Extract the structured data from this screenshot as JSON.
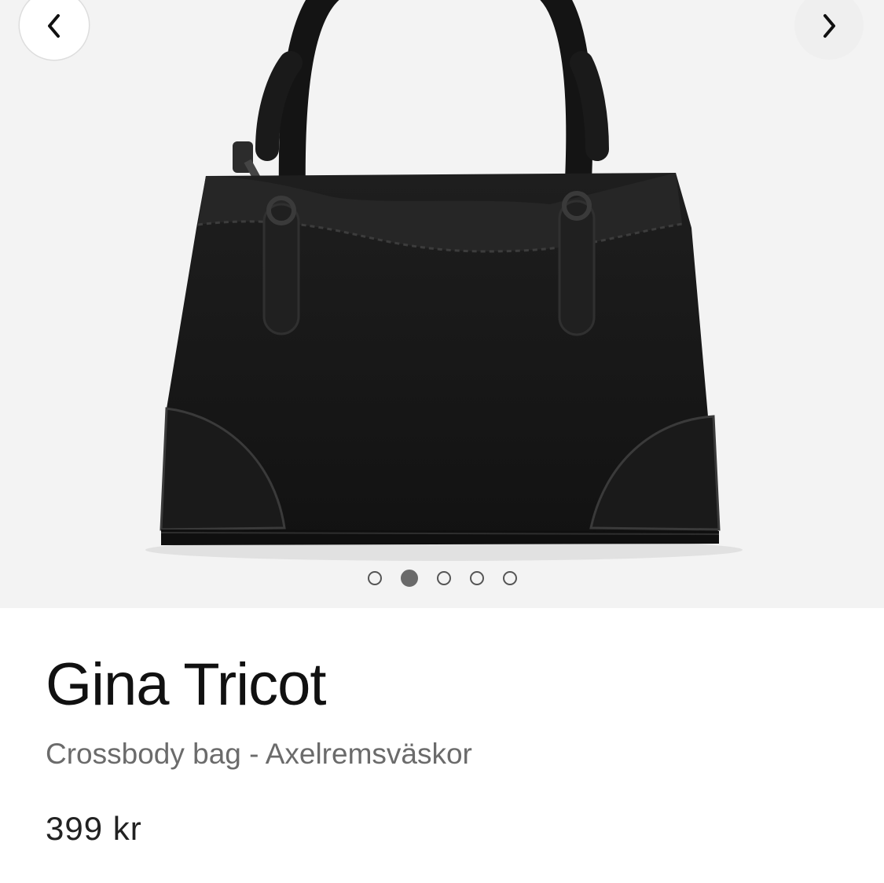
{
  "gallery": {
    "prev_icon": "chevron-left-icon",
    "next_icon": "chevron-right-icon",
    "image_subject": "black handbag",
    "dot_count": 5,
    "active_dot": 2
  },
  "product": {
    "brand": "Gina Tricot",
    "subtitle": "Crossbody bag - Axelremsväskor",
    "price": "399 kr"
  },
  "colors": {
    "gallery_background": "#f3f3f3",
    "bag": "#1b1b1b",
    "brand_text": "#111111",
    "subtitle_text": "#6b6b6b"
  }
}
